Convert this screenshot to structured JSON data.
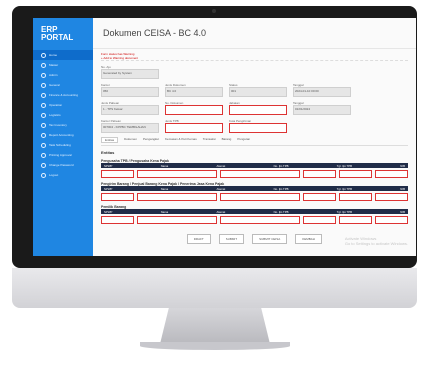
{
  "app": {
    "logo_line1": "ERP",
    "logo_line2": "PORTAL"
  },
  "header": {
    "title": "Dokumen CEISA - BC 4.0"
  },
  "sidebar": {
    "items": [
      {
        "label": "Home"
      },
      {
        "label": "Master"
      },
      {
        "label": "Admin"
      },
      {
        "label": "General"
      },
      {
        "label": "Finance & Accounting"
      },
      {
        "label": "Operation"
      },
      {
        "label": "Logistics"
      },
      {
        "label": "Tax Inventory"
      },
      {
        "label": "Report Accounting"
      },
      {
        "label": "Task Scheduling"
      },
      {
        "label": "Printing Approval"
      },
      {
        "label": "Change Password"
      },
      {
        "label": "Logout"
      }
    ]
  },
  "breadcrumb": {
    "line1": "Form status has Warning",
    "line2": "+ Add to Warning document"
  },
  "form": {
    "no_aju_label": "No. Aju",
    "no_aju_value": "Generated by System",
    "r2": [
      {
        "label": "Kantor",
        "value": "050"
      },
      {
        "label": "Jenis Dokumen",
        "value": "BC 4.0"
      },
      {
        "label": "Status",
        "value": "001"
      },
      {
        "label": "Tanggal",
        "value": "2024-01-10 00:00"
      }
    ],
    "r3": [
      {
        "label": "Jenis Pabean",
        "value": "1 - TPS Keluar"
      },
      {
        "label": "No. Dokumen",
        "value": ""
      },
      {
        "label": "Jabatan",
        "value": ""
      },
      {
        "label": "Tanggal",
        "value": "01/01/2024"
      }
    ],
    "r4": [
      {
        "label": "Kantor Pabean",
        "value": "007004 - KPPBC TEMBILAHAN"
      },
      {
        "label": "Jenis TPB",
        "value": ""
      },
      {
        "label": "Kota Pengiriman",
        "value": ""
      }
    ]
  },
  "tabs": [
    "Entitas",
    "Dokumen",
    "Pengangkut",
    "Kemasan & Peti Kemas",
    "Transaksi",
    "Barang",
    "Pungutan"
  ],
  "section": {
    "title": "Entitas"
  },
  "entities": [
    {
      "title": "Pengusaha TPB / Pengusaha Kena Pajak",
      "cols": [
        "NPWP",
        "Nama",
        "Alamat",
        "No. Ijin TPB",
        "Tgl. Ijin TPB",
        "NIB"
      ]
    },
    {
      "title": "Pengirim Barang / Penjual Barang Kena Pajak / Penerima Jasa Kena Pajak",
      "cols": [
        "NPWP",
        "Nama",
        "Alamat",
        "No. Ijin TPB",
        "Tgl. Ijin TPB",
        "NIB"
      ]
    },
    {
      "title": "Pemilik Barang",
      "cols": [
        "NPWP",
        "Nama",
        "Alamat",
        "No. Ijin TPB",
        "Tgl. Ijin TPB",
        "NIB"
      ]
    }
  ],
  "actions": {
    "draft": "DRAFT",
    "submit": "SUBMIT",
    "submit_ceisa": "SUBMIT CEISA",
    "kembali": "KEMBALI"
  },
  "watermark": {
    "line1": "Activate Windows",
    "line2": "Go to Settings to activate Windows."
  }
}
